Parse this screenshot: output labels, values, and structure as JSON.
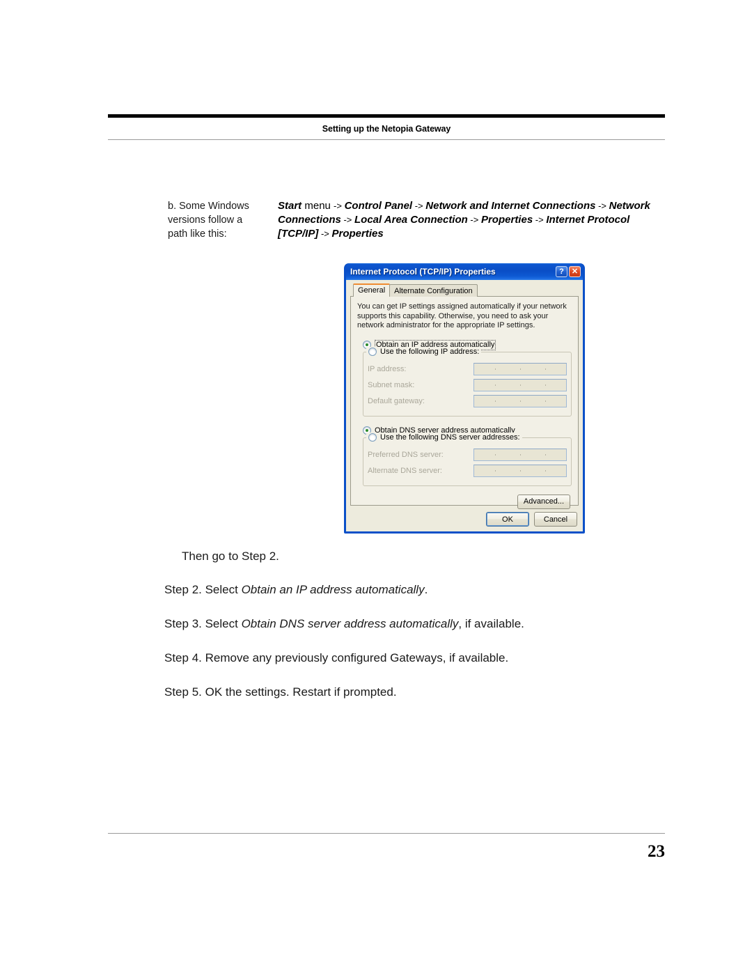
{
  "header": {
    "title": "Setting up the Netopia Gateway"
  },
  "intro": {
    "left_lines": [
      "b. Some Windows",
      "versions follow a",
      "path like this:"
    ],
    "path_parts": [
      {
        "text": "Start",
        "style": "bolditalic"
      },
      {
        "text": " menu ",
        "style": "plain"
      },
      {
        "text": "-> ",
        "style": "arrow"
      },
      {
        "text": "Control Panel",
        "style": "bolditalic"
      },
      {
        "text": " -> ",
        "style": "arrow"
      },
      {
        "text": "Network and Internet Connections",
        "style": "bolditalic"
      },
      {
        "text": " -> ",
        "style": "arrow"
      },
      {
        "text": "Network Connections",
        "style": "bolditalic"
      },
      {
        "text": " -> ",
        "style": "arrow"
      },
      {
        "text": "Local Area Connection",
        "style": "bolditalic"
      },
      {
        "text": " -> ",
        "style": "arrow"
      },
      {
        "text": "Properties",
        "style": "bolditalic"
      },
      {
        "text": " -> ",
        "style": "arrow"
      },
      {
        "text": "Internet Protocol [TCP/IP]",
        "style": "bolditalic"
      },
      {
        "text": " -> ",
        "style": "arrow"
      },
      {
        "text": "Properties",
        "style": "bolditalic"
      }
    ],
    "path_text_full": "Start menu -> Control Panel -> Network and Internet Connections -> Network Connections -> Local Area Connection -> Properties -> Internet Protocol [TCP/IP] -> Properties"
  },
  "dialog": {
    "title": "Internet Protocol (TCP/IP) Properties",
    "help_button": "?",
    "close_button": "✕",
    "tabs": [
      {
        "label": "General",
        "active": true
      },
      {
        "label": "Alternate Configuration",
        "active": false
      }
    ],
    "description": "You can get IP settings assigned automatically if your network supports this capability. Otherwise, you need to ask your network administrator for the appropriate IP settings.",
    "ip_section": {
      "auto_radio_label": "Obtain an IP address automatically",
      "auto_radio_selected": true,
      "manual_radio_label": "Use the following IP address:",
      "manual_radio_selected": false,
      "fields": [
        {
          "label": "IP address:",
          "value": ""
        },
        {
          "label": "Subnet mask:",
          "value": ""
        },
        {
          "label": "Default gateway:",
          "value": ""
        }
      ]
    },
    "dns_section": {
      "auto_radio_label": "Obtain DNS server address automatically",
      "auto_radio_selected": true,
      "manual_radio_label": "Use the following DNS server addresses:",
      "manual_radio_selected": false,
      "fields": [
        {
          "label": "Preferred DNS server:",
          "value": ""
        },
        {
          "label": "Alternate DNS server:",
          "value": ""
        }
      ]
    },
    "buttons": {
      "advanced": "Advanced...",
      "ok": "OK",
      "cancel": "Cancel"
    },
    "colors": {
      "titlebar_blue": "#0a50c8",
      "dialog_face": "#edebdd",
      "tab_panel": "#f2f0e6",
      "tab_accent_orange": "#ef8c32",
      "radio_dot_green": "#2b8a2b",
      "close_red": "#e04a22"
    }
  },
  "steps": {
    "then_go_to": "Then go to Step 2.",
    "items": [
      {
        "prefix": "Step 2. Select ",
        "emphasis": "Obtain an IP address automatically",
        "suffix": "."
      },
      {
        "prefix": "Step 3. Select ",
        "emphasis": "Obtain DNS server address automatically",
        "suffix": ", if available."
      },
      {
        "prefix": "Step 4. Remove any previously configured Gateways, if available.",
        "emphasis": "",
        "suffix": ""
      },
      {
        "prefix": "Step 5. OK the settings. Restart if prompted.",
        "emphasis": "",
        "suffix": ""
      }
    ]
  },
  "footer": {
    "page_number": "23"
  }
}
